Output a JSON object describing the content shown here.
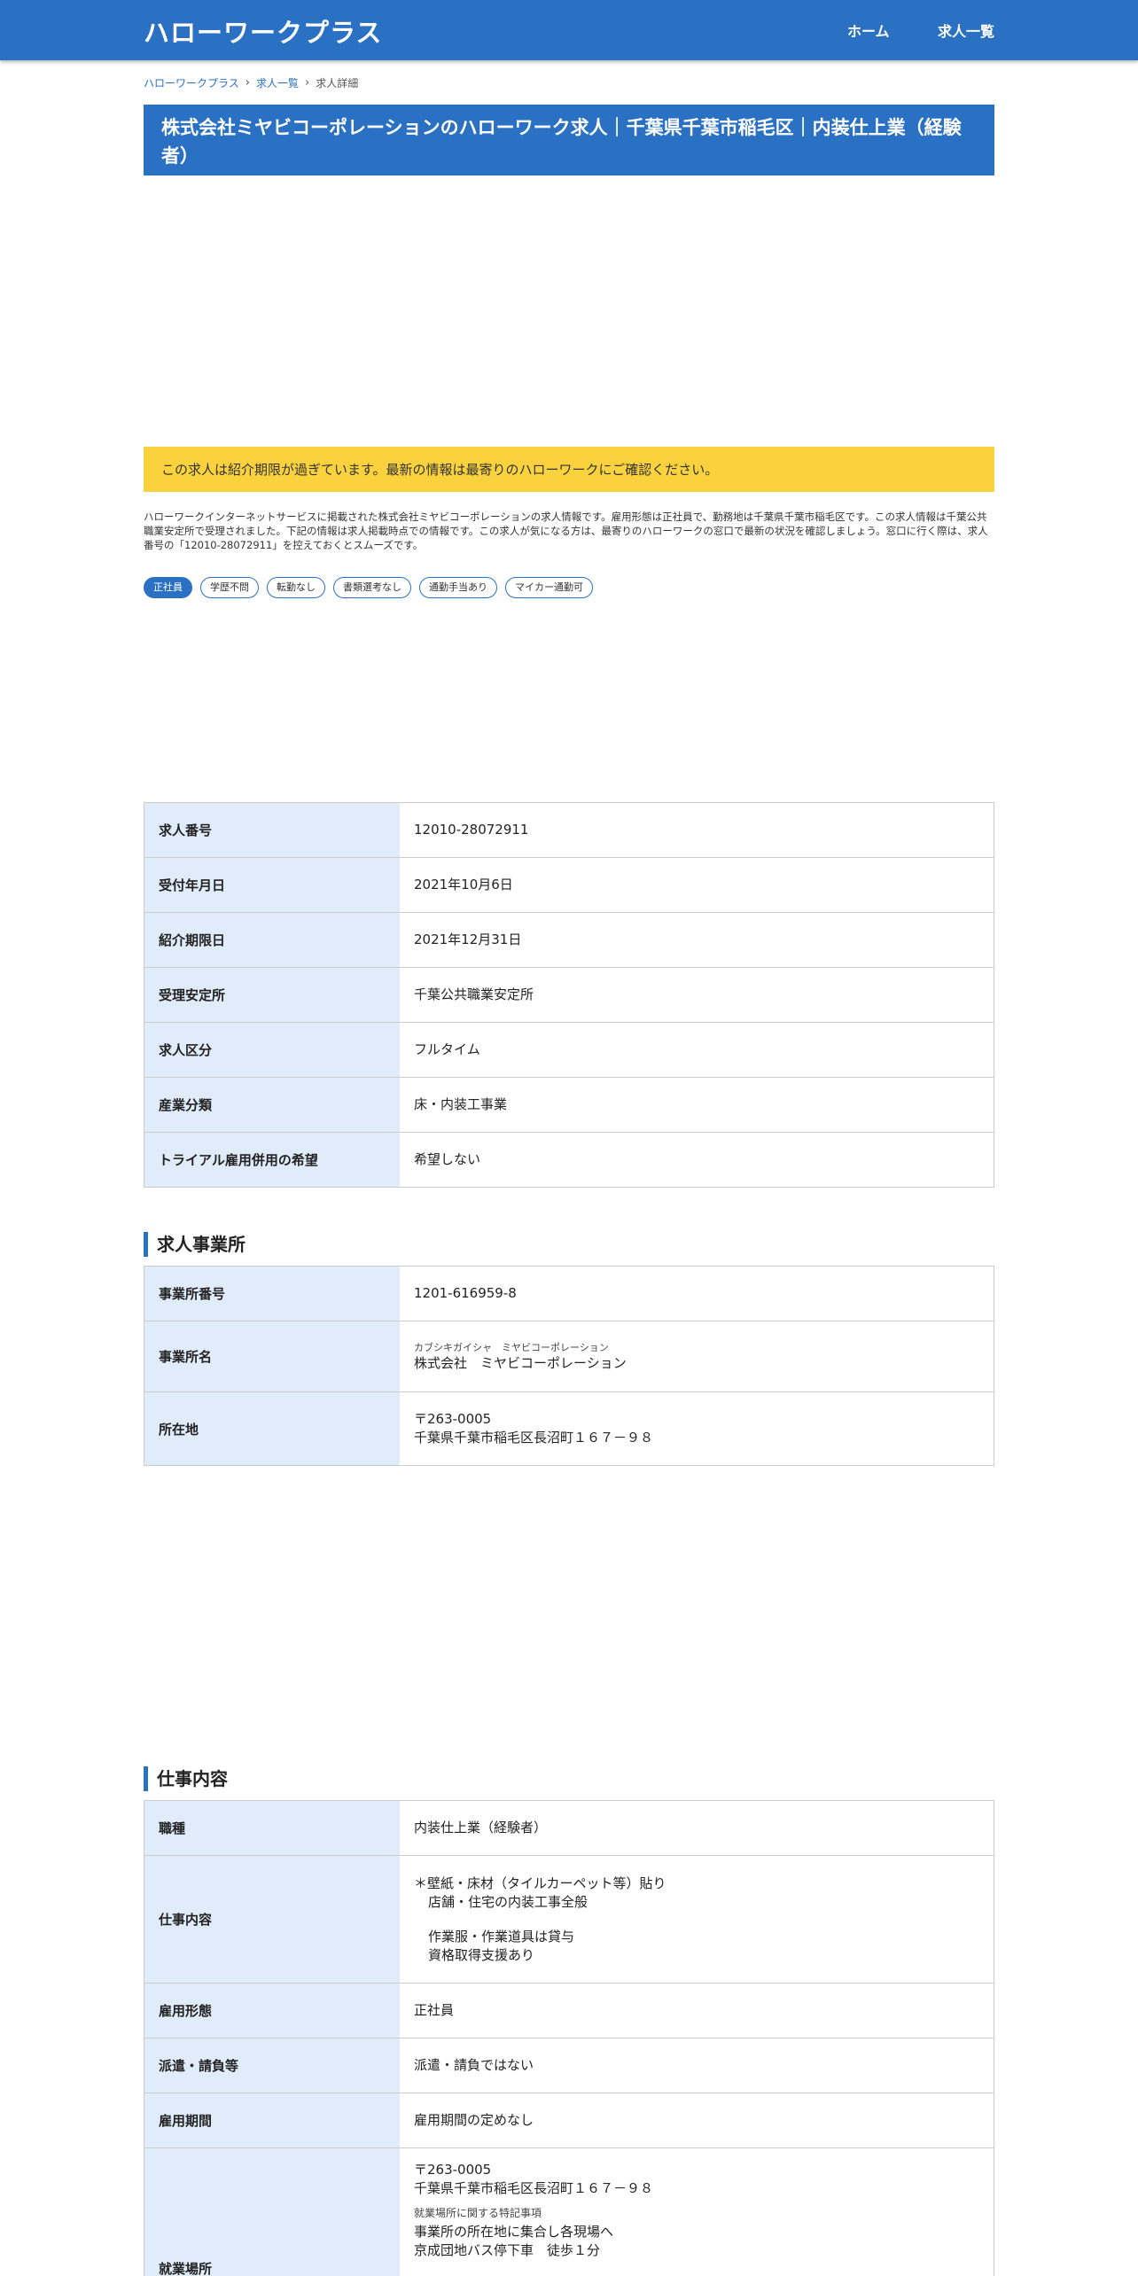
{
  "header": {
    "site_title": "ハローワークプラス",
    "nav": {
      "home": "ホーム",
      "job_list": "求人一覧"
    }
  },
  "breadcrumb": [
    "ハローワークプラス",
    "求人一覧",
    "求人詳細"
  ],
  "page_title": "株式会社ミヤビコーポレーションのハローワーク求人｜千葉県千葉市稲毛区｜内装仕上業（経験者）",
  "notice": "この求人は紹介期限が過ぎています。最新の情報は最寄りのハローワークにご確認ください。",
  "intro": "ハローワークインターネットサービスに掲載された株式会社ミヤビコーポレーションの求人情報です。雇用形態は正社員で、勤務地は千葉県千葉市稲毛区です。この求人情報は千葉公共職業安定所で受理されました。下記の情報は求人掲載時点での情報です。この求人が気になる方は、最寄りのハローワークの窓口で最新の状況を確認しましょう。窓口に行く際は、求人番号の「12010-28072911」を控えておくとスムーズです。",
  "tags": [
    "正社員",
    "学歴不問",
    "転勤なし",
    "書類選考なし",
    "通勤手当あり",
    "マイカー通勤可"
  ],
  "summary_table": [
    {
      "label": "求人番号",
      "value": "12010-28072911"
    },
    {
      "label": "受付年月日",
      "value": "2021年10月6日"
    },
    {
      "label": "紹介期限日",
      "value": "2021年12月31日"
    },
    {
      "label": "受理安定所",
      "value": "千葉公共職業安定所"
    },
    {
      "label": "求人区分",
      "value": "フルタイム"
    },
    {
      "label": "産業分類",
      "value": "床・内装工事業"
    },
    {
      "label": "トライアル雇用併用の希望",
      "value": "希望しない"
    }
  ],
  "office_section": {
    "heading": "求人事業所",
    "office_number_label": "事業所番号",
    "office_number": "1201-616959-8",
    "office_name_label": "事業所名",
    "office_name_kana": "カブシキガイシャ　ミヤビコーポレーション",
    "office_name": "株式会社　ミヤビコーポレーション",
    "address_label": "所在地",
    "postal": "〒263-0005",
    "address": "千葉県千葉市稲毛区長沼町１６７－９８"
  },
  "job_section": {
    "heading": "仕事内容",
    "occupation_label": "職種",
    "occupation": "内装仕上業（経験者）",
    "description_label": "仕事内容",
    "description_lines": [
      "＊壁紙・床材（タイルカーペット等）貼り",
      "店舗・住宅の内装工事全般",
      "作業服・作業道具は貸与",
      "資格取得支援あり"
    ],
    "employment_type_label": "雇用形態",
    "employment_type": "正社員",
    "dispatch_label": "派遣・請負等",
    "dispatch": "派遣・請負ではない",
    "period_label": "雇用期間",
    "period": "雇用期間の定めなし",
    "workplace_label": "就業場所",
    "workplace_postal": "〒263-0005",
    "workplace_address": "千葉県千葉市稲毛区長沼町１６７－９８",
    "workplace_note_label": "就業場所に関する特記事項",
    "workplace_note_lines": [
      "事業所の所在地に集合し各現場へ",
      "京成団地バス停下車　徒歩１分"
    ]
  }
}
